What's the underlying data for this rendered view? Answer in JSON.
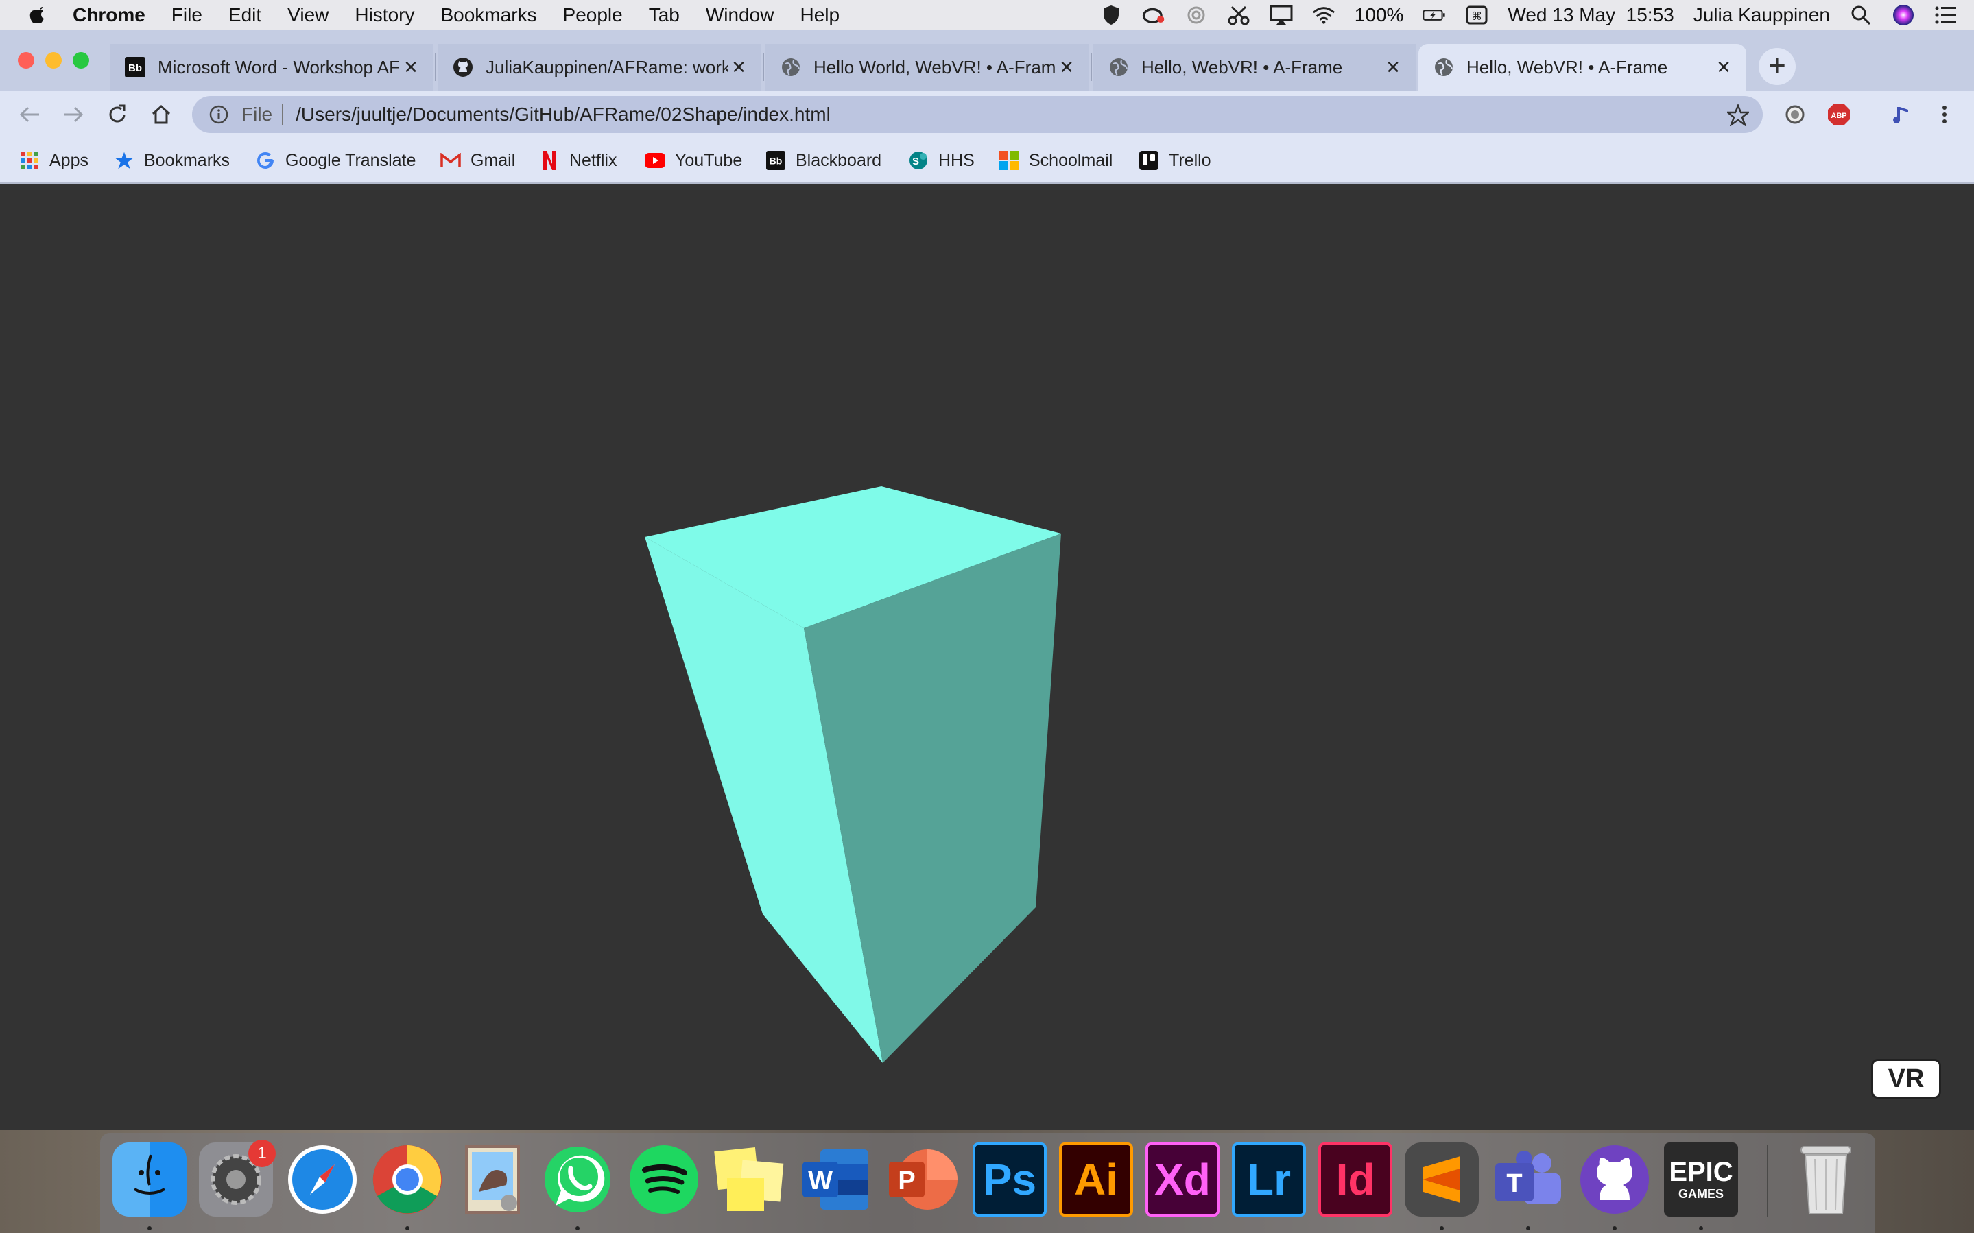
{
  "menubar": {
    "app_name": "Chrome",
    "menus": [
      "File",
      "Edit",
      "View",
      "History",
      "Bookmarks",
      "People",
      "Tab",
      "Window",
      "Help"
    ],
    "battery": "100%",
    "datetime": "Wed 13 May  15:53",
    "user": "Julia Kauppinen"
  },
  "tabs": [
    {
      "label": "Microsoft Word - Workshop AF",
      "favicon": "blackboard-icon"
    },
    {
      "label": "JuliaKauppinen/AFRame: works",
      "favicon": "github-icon"
    },
    {
      "label": "Hello World, WebVR! • A-Frame",
      "favicon": "globe-icon"
    },
    {
      "label": "Hello, WebVR! • A-Frame",
      "favicon": "globe-icon"
    },
    {
      "label": "Hello, WebVR! • A-Frame",
      "favicon": "globe-icon",
      "active": true
    }
  ],
  "toolbar": {
    "scheme": "File",
    "url": "/Users/juultje/Documents/GitHub/AFRame/02Shape/index.html"
  },
  "bookmarks": [
    "Apps",
    "Bookmarks",
    "Google Translate",
    "Gmail",
    "Netflix",
    "YouTube",
    "Blackboard",
    "HHS",
    "Schoolmail",
    "Trello"
  ],
  "scene": {
    "background": "#333333",
    "box_top_color": "#7ffbe9",
    "box_front_color": "#80f9e8",
    "box_side_color": "#55a397",
    "vr_button_label": "VR"
  },
  "dock": {
    "apps": [
      {
        "name": "Finder"
      },
      {
        "name": "System Preferences",
        "badge": "1"
      },
      {
        "name": "Safari"
      },
      {
        "name": "Chrome"
      },
      {
        "name": "Preview"
      },
      {
        "name": "WhatsApp"
      },
      {
        "name": "Spotify"
      },
      {
        "name": "Stickies"
      },
      {
        "name": "Word"
      },
      {
        "name": "PowerPoint"
      },
      {
        "name": "Photoshop",
        "label": "Ps"
      },
      {
        "name": "Illustrator",
        "label": "Ai"
      },
      {
        "name": "XD",
        "label": "Xd"
      },
      {
        "name": "Lightroom",
        "label": "Lr"
      },
      {
        "name": "InDesign",
        "label": "Id"
      },
      {
        "name": "Sublime Text"
      },
      {
        "name": "Teams"
      },
      {
        "name": "GitHub Desktop"
      },
      {
        "name": "Epic Games",
        "label": "EPIC",
        "sublabel": "GAMES"
      },
      {
        "name": "Trash"
      }
    ]
  }
}
